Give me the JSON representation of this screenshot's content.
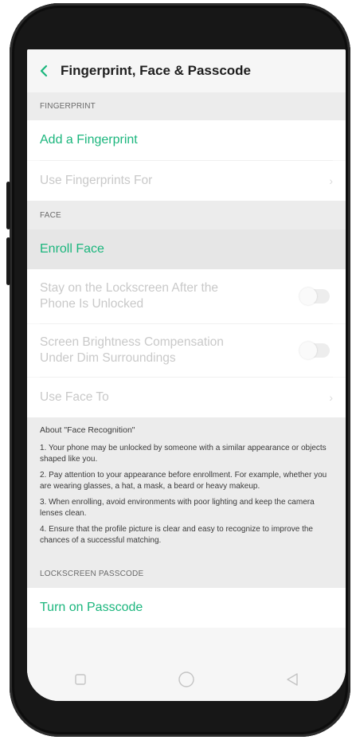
{
  "header": {
    "title": "Fingerprint, Face & Passcode",
    "back_icon": "chevron-left-icon"
  },
  "fingerprint": {
    "section_label": "FINGERPRINT",
    "add_label": "Add a Fingerprint",
    "use_for_label": "Use Fingerprints For"
  },
  "face": {
    "section_label": "FACE",
    "enroll_label": "Enroll Face",
    "stay_lockscreen_label": "Stay on the Lockscreen After the Phone Is Unlocked",
    "stay_lockscreen_on": false,
    "brightness_label": "Screen Brightness Compensation Under Dim Surroundings",
    "brightness_on": false,
    "use_face_label": "Use Face To"
  },
  "about": {
    "title": "About \"Face Recognition\"",
    "items": [
      "1. Your phone may be unlocked by someone with a similar appearance or objects shaped like you.",
      "2. Pay attention to your appearance before enrollment. For example, whether you are wearing glasses, a hat, a mask, a beard or heavy makeup.",
      "3. When enrolling, avoid environments with poor lighting and keep the camera lenses clean.",
      "4. Ensure that the profile picture is clear and easy to recognize to improve the chances of a successful matching."
    ]
  },
  "passcode": {
    "section_label": "LOCKSCREEN PASSCODE",
    "turn_on_label": "Turn on Passcode"
  },
  "colors": {
    "accent": "#1bb67d",
    "disabled_text": "#c9c9c9",
    "section_bg": "#ececec"
  },
  "navbar": {
    "icons": [
      "square-icon",
      "circle-icon",
      "triangle-back-icon"
    ]
  }
}
